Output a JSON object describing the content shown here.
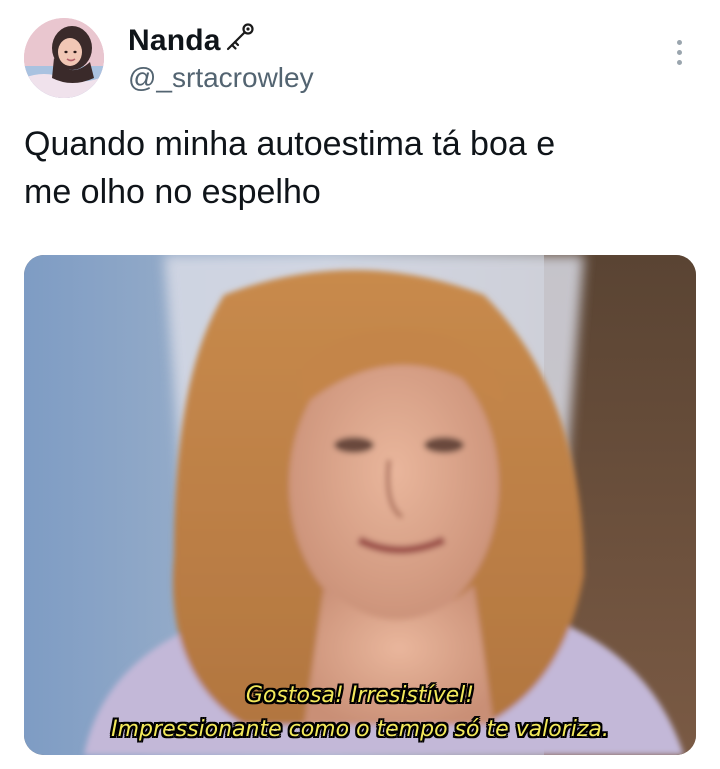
{
  "author": {
    "display_name": "Nanda",
    "name_emoji": "key-emoji",
    "handle": "@_srtacrowley",
    "avatar": "profile-photo"
  },
  "tweet": {
    "text_line1": "Quando minha autoestima tá boa e",
    "text_line2": "me olho no espelho"
  },
  "media": {
    "description_icon": "meme-image",
    "subtitle_line1": "Gostosa! Irresistível!",
    "subtitle_line2": "Impressionante como o tempo só te valoriza.",
    "subtitle_color": "#f2e85a"
  },
  "menu": {
    "icon": "more-vertical-icon"
  },
  "colors": {
    "text_primary": "#0f1419",
    "text_secondary": "#536471"
  }
}
